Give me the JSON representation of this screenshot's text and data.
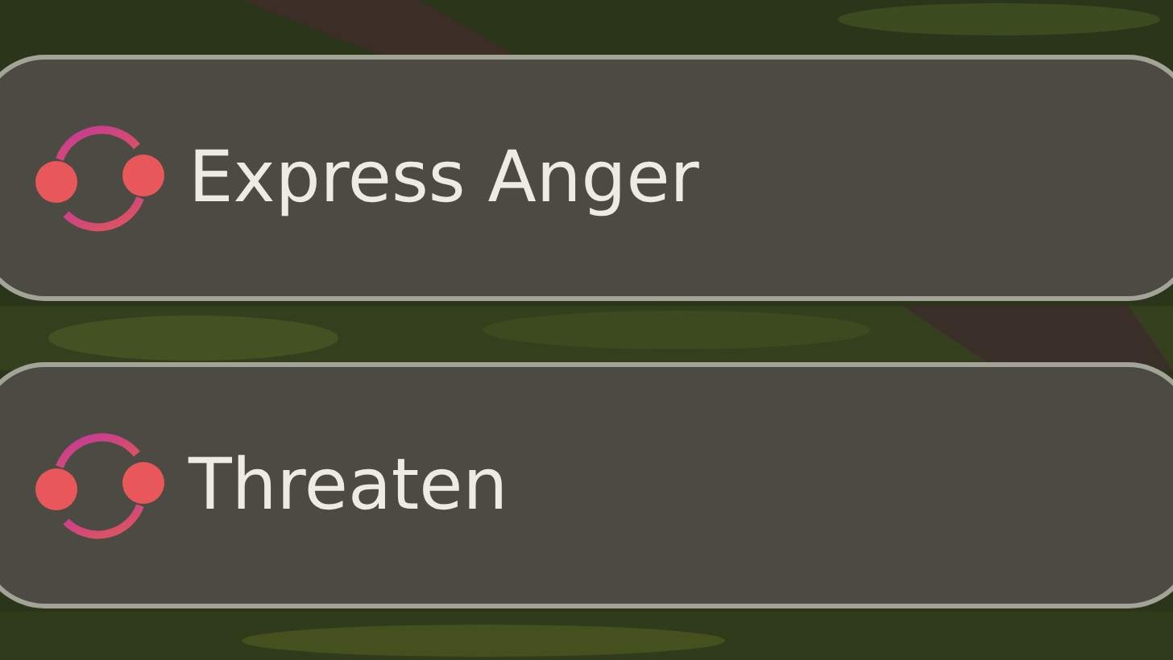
{
  "options": [
    {
      "label": "Express Anger"
    },
    {
      "label": "Threaten"
    }
  ]
}
